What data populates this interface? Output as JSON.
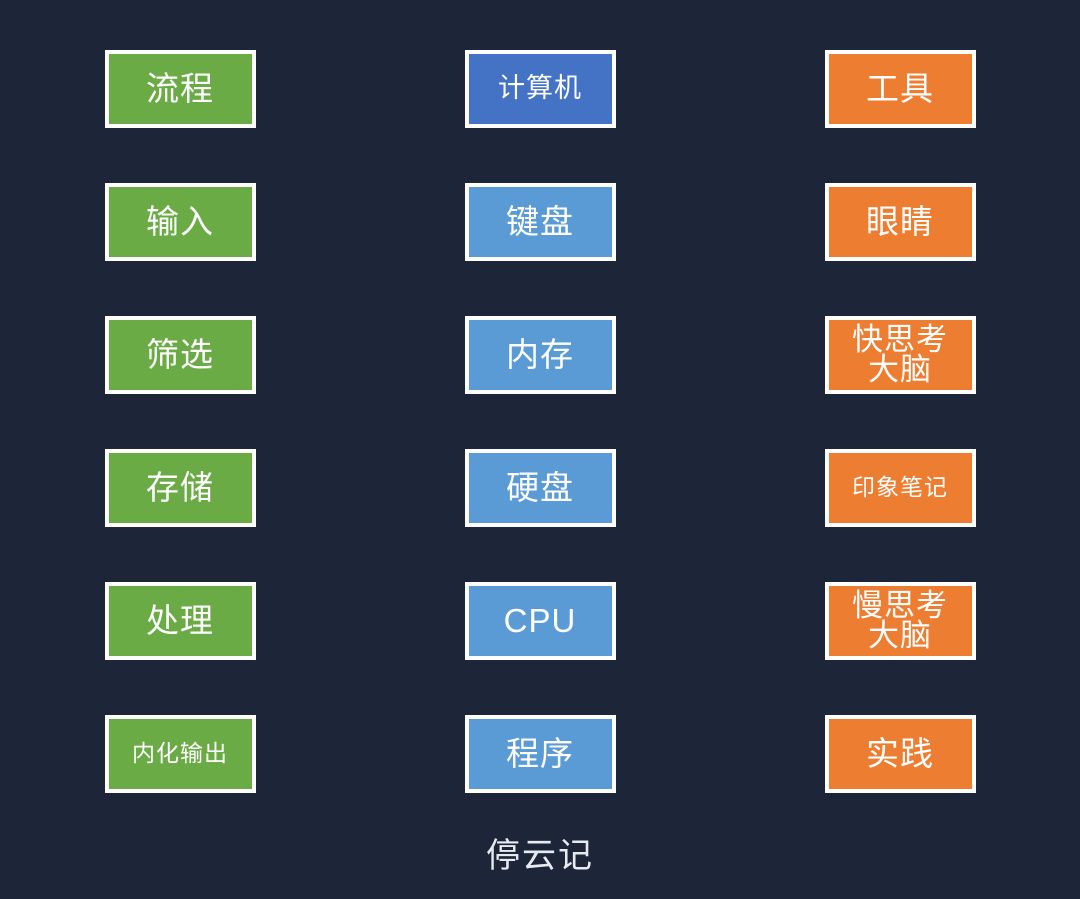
{
  "background_color": "#1d2639",
  "border_color": "#ffffff",
  "text_color": "#ffffff",
  "caption": "停云记",
  "columns": [
    {
      "name": "process-column",
      "color": "#6aab46",
      "items": [
        {
          "label": "流程",
          "size": "size-lg",
          "lines": 1
        },
        {
          "label": "输入",
          "size": "size-lg",
          "lines": 1
        },
        {
          "label": "筛选",
          "size": "size-lg",
          "lines": 1
        },
        {
          "label": "存储",
          "size": "size-lg",
          "lines": 1
        },
        {
          "label": "处理",
          "size": "size-lg",
          "lines": 1
        },
        {
          "label": "内化输出",
          "size": "size-sm",
          "lines": 1
        }
      ]
    },
    {
      "name": "computer-column",
      "color": "#5b9bd5",
      "items": [
        {
          "label": "计算机",
          "size": "size-md",
          "lines": 1,
          "fill": "#4472c4"
        },
        {
          "label": "键盘",
          "size": "size-lg",
          "lines": 1
        },
        {
          "label": "内存",
          "size": "size-lg",
          "lines": 1
        },
        {
          "label": "硬盘",
          "size": "size-lg",
          "lines": 1
        },
        {
          "label": "CPU",
          "size": "size-lg",
          "lines": 1
        },
        {
          "label": "程序",
          "size": "size-lg",
          "lines": 1
        }
      ]
    },
    {
      "name": "human-tools-column",
      "color": "#ed7d31",
      "items": [
        {
          "label": "工具",
          "size": "size-lg",
          "lines": 1
        },
        {
          "label": "眼睛",
          "size": "size-lg",
          "lines": 1
        },
        {
          "label": "快思考\n大脑",
          "size": "size-lg",
          "lines": 2
        },
        {
          "label": "印象笔记",
          "size": "size-sm",
          "lines": 1
        },
        {
          "label": "慢思考\n大脑",
          "size": "size-lg",
          "lines": 2
        },
        {
          "label": "实践",
          "size": "size-lg",
          "lines": 1
        }
      ]
    }
  ]
}
